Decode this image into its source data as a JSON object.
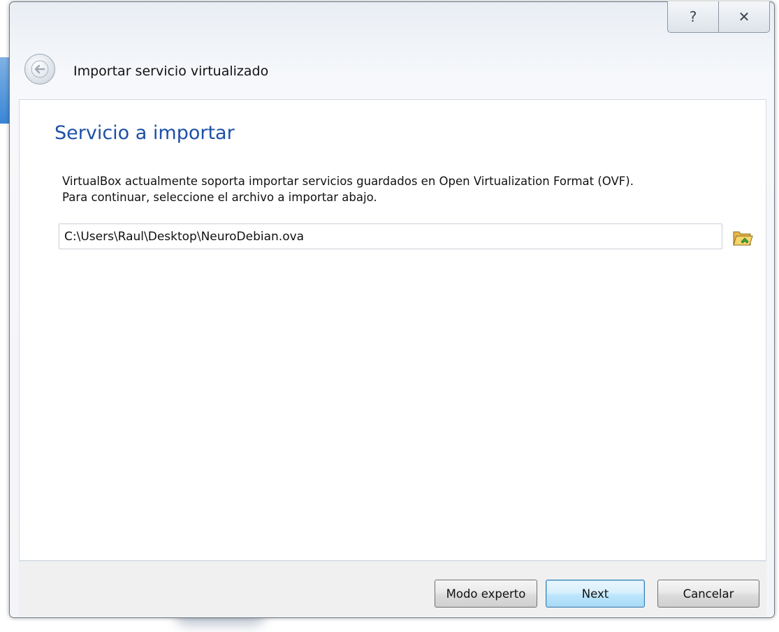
{
  "window": {
    "help_icon": "help-question-icon",
    "close_icon": "close-x-icon",
    "help_glyph": "?",
    "close_glyph": "✕"
  },
  "wizard": {
    "back_icon": "back-arrow-icon",
    "title": "Importar servicio virtualizado"
  },
  "page": {
    "heading": "Servicio a importar",
    "description_line1": "VirtualBox actualmente soporta importar servicios guardados en Open Virtualization Format (OVF).",
    "description_line2": "Para continuar, seleccione el archivo a importar abajo.",
    "file_path": "C:\\Users\\Raul\\Desktop\\NeuroDebian.ova",
    "browse_icon": "open-folder-icon"
  },
  "buttons": {
    "expert": "Modo experto",
    "next": "Next",
    "cancel": "Cancelar"
  },
  "colors": {
    "heading": "#1e4fa6",
    "next_border": "#3c7fb1"
  }
}
